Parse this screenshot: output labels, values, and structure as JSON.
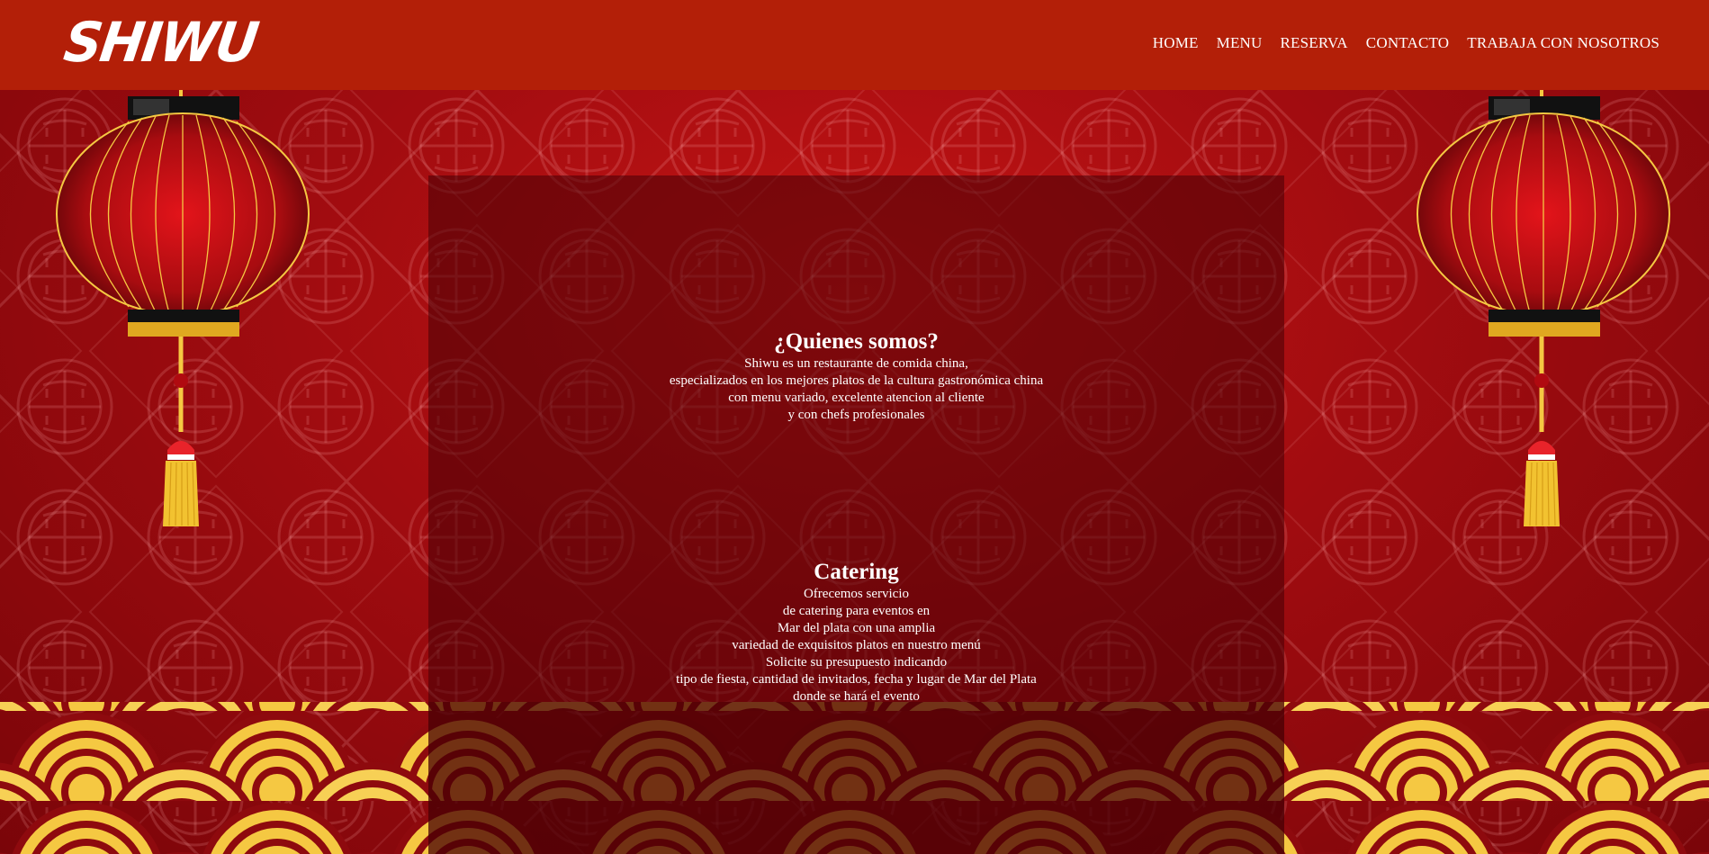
{
  "brand": {
    "logo_text": "SHIWU"
  },
  "nav": {
    "items": [
      {
        "label": "HOME"
      },
      {
        "label": "MENU"
      },
      {
        "label": "RESERVA"
      },
      {
        "label": "CONTACTO"
      },
      {
        "label": "TRABAJA CON NOSOTROS"
      }
    ]
  },
  "about": {
    "title": "¿Quienes somos?",
    "lines": [
      "Shiwu es un restaurante de comida china,",
      "especializados en los mejores platos de la cultura gastronómica china",
      "con menu variado, excelente atencion al cliente",
      "y con chefs profesionales"
    ]
  },
  "catering": {
    "title": "Catering",
    "lines": [
      "Ofrecemos servicio",
      "de catering para eventos en",
      "Mar del plata con una amplia",
      "variedad de exquisitos platos en nuestro menú",
      "Solicite su presupuesto indicando",
      "tipo de fiesta, cantidad de invitados, fecha y lugar de Mar del Plata",
      "donde se hará el evento"
    ]
  },
  "colors": {
    "header": "#b31f08",
    "background": "#a10c10",
    "gold": "#f5c842",
    "wave_dark": "#8e0a0e"
  },
  "icons": [
    "lantern-icon",
    "chinese-pattern-icon",
    "wave-pattern-icon"
  ]
}
